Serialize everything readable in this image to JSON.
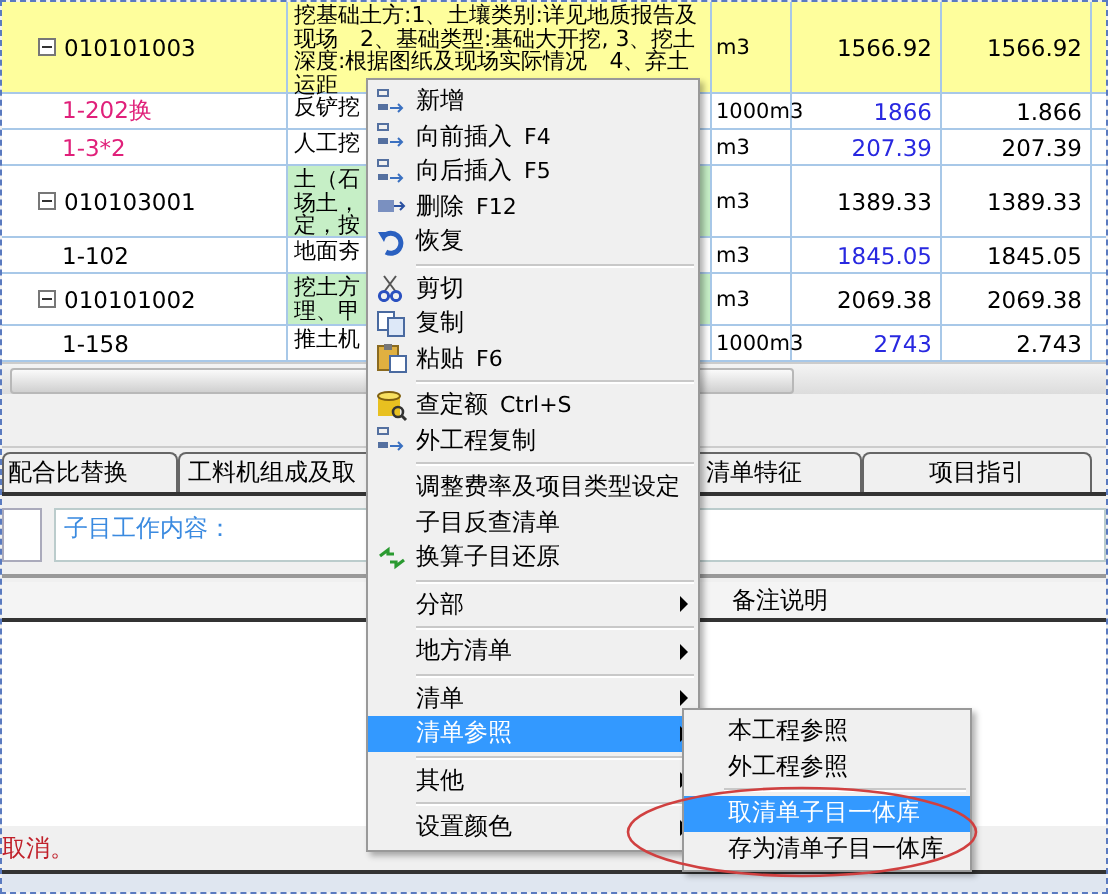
{
  "table": {
    "rows": [
      {
        "kind": "bill",
        "selected": true,
        "code": "010101003",
        "desc": "挖基础土方:1、土壤类别:详见地质报告及现场　2、基础类型:基础大开挖, 3、挖土深度:根据图纸及现场实际情况　4、弃土运距",
        "unit": "m3",
        "qty": "1566.92",
        "qty2": "1566.92"
      },
      {
        "kind": "changed",
        "selected": false,
        "code": "1-202换",
        "desc": "反铲挖",
        "unit": "1000m3",
        "qty": "1866",
        "qty2": "1.866"
      },
      {
        "kind": "changed",
        "selected": false,
        "code": "1-3*2",
        "desc": "人工挖",
        "unit": "m3",
        "qty": "207.39",
        "qty2": "207.39"
      },
      {
        "kind": "bill",
        "selected": false,
        "code": "010103001",
        "desc": "土（石场土，定，按",
        "unit": "m3",
        "qty": "1389.33",
        "qty2": "1389.33"
      },
      {
        "kind": "item",
        "selected": false,
        "code": "1-102",
        "desc": "地面夯",
        "unit": "m3",
        "qty": "1845.05",
        "qty2": "1845.05"
      },
      {
        "kind": "bill",
        "selected": false,
        "code": "010101002",
        "desc": "挖土方理、甲",
        "unit": "m3",
        "qty": "2069.38",
        "qty2": "2069.38"
      },
      {
        "kind": "item",
        "selected": false,
        "code": "1-158",
        "desc": "推土机",
        "unit": "1000m3",
        "qty": "2743",
        "qty2": "2.743"
      }
    ]
  },
  "tabs": [
    {
      "label": "配合比替换",
      "selected": false
    },
    {
      "label": "工料机组成及取",
      "selected": false
    },
    {
      "label": "清单特征",
      "selected": false
    },
    {
      "label": "项目指引",
      "selected": false
    }
  ],
  "work_content": {
    "label": "子目工作内容："
  },
  "notes_header": "备注说明",
  "status": "取消。",
  "context_menu": [
    {
      "kind": "item",
      "label": "新增",
      "selected": false
    },
    {
      "kind": "item",
      "label": "向前插入",
      "shortcut": "F4",
      "selected": false
    },
    {
      "kind": "item",
      "label": "向后插入",
      "shortcut": "F5",
      "selected": false
    },
    {
      "kind": "item",
      "label": "删除",
      "shortcut": "F12",
      "selected": false
    },
    {
      "kind": "item",
      "label": "恢复",
      "selected": false
    },
    {
      "kind": "separator"
    },
    {
      "kind": "item",
      "label": "剪切",
      "selected": false
    },
    {
      "kind": "item",
      "label": "复制",
      "selected": false
    },
    {
      "kind": "item",
      "label": "粘贴",
      "shortcut": "F6",
      "selected": false
    },
    {
      "kind": "separator"
    },
    {
      "kind": "item",
      "label": "查定额",
      "shortcut": "Ctrl+S",
      "selected": false
    },
    {
      "kind": "item",
      "label": "外工程复制",
      "selected": false
    },
    {
      "kind": "separator"
    },
    {
      "kind": "item",
      "label": "调整费率及项目类型设定",
      "selected": false
    },
    {
      "kind": "item",
      "label": "子目反查清单",
      "selected": false
    },
    {
      "kind": "item",
      "label": "换算子目还原",
      "selected": false
    },
    {
      "kind": "separator"
    },
    {
      "kind": "submenu",
      "label": "分部",
      "selected": false
    },
    {
      "kind": "separator"
    },
    {
      "kind": "submenu",
      "label": "地方清单",
      "selected": false
    },
    {
      "kind": "separator"
    },
    {
      "kind": "submenu",
      "label": "清单",
      "selected": false
    },
    {
      "kind": "submenu",
      "label": "清单参照",
      "selected": true
    },
    {
      "kind": "separator"
    },
    {
      "kind": "submenu",
      "label": "其他",
      "selected": false
    },
    {
      "kind": "separator"
    },
    {
      "kind": "submenu",
      "label": "设置颜色",
      "selected": false
    }
  ],
  "submenu": [
    {
      "kind": "item",
      "label": "本工程参照",
      "selected": false
    },
    {
      "kind": "item",
      "label": "外工程参照",
      "selected": false
    },
    {
      "kind": "separator"
    },
    {
      "kind": "item",
      "label": "取清单子目一体库",
      "selected": true
    },
    {
      "kind": "item",
      "label": "存为清单子目一体库",
      "selected": false
    }
  ]
}
